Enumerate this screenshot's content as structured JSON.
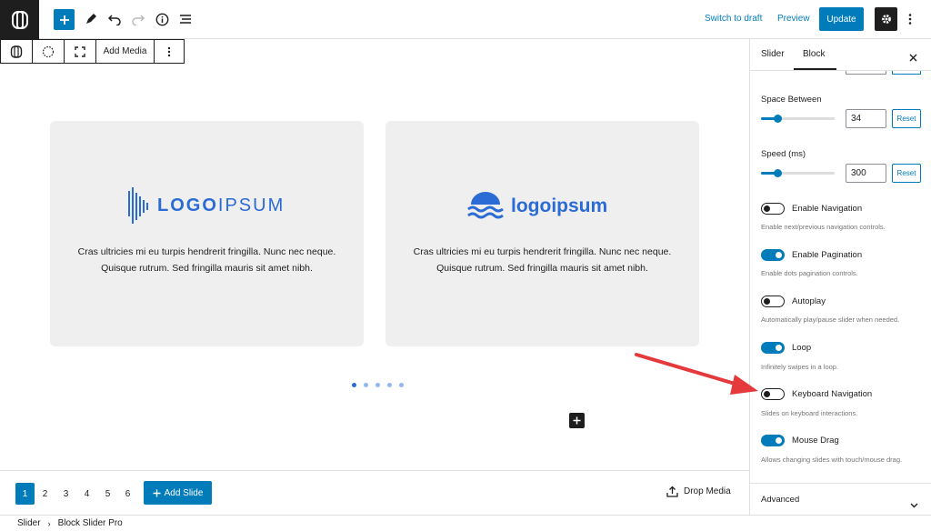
{
  "topbar": {
    "switch_to_draft": "Switch to draft",
    "preview": "Preview",
    "update": "Update"
  },
  "block_toolbar": {
    "add_media": "Add Media"
  },
  "slides": [
    {
      "logo_text_bold": "LOGO",
      "logo_text_light": "IPSUM",
      "text_line1": "Cras ultricies mi eu turpis hendrerit fringilla. Nunc nec neque.",
      "text_line2": "Quisque rutrum. Sed fringilla mauris sit amet nibh."
    },
    {
      "logo_text": "logoipsum",
      "text_line1": "Cras ultricies mi eu turpis hendrerit fringilla. Nunc nec neque.",
      "text_line2": "Quisque rutrum. Sed fringilla mauris sit amet nibh."
    }
  ],
  "pagination_dots": {
    "count": 5,
    "active_index": 0
  },
  "slide_bar": {
    "slide_numbers": [
      "1",
      "2",
      "3",
      "4",
      "5",
      "6"
    ],
    "active_slide": "1",
    "add_slide": "Add Slide",
    "drop_media": "Drop Media"
  },
  "breadcrumb": [
    "Slider",
    "Block Slider Pro"
  ],
  "sidebar": {
    "tabs": [
      "Slider",
      "Block"
    ],
    "active_tab": "Block",
    "space_between": {
      "label": "Space Between",
      "value": "34",
      "reset": "Reset",
      "fraction": 0.22
    },
    "speed": {
      "label": "Speed (ms)",
      "value": "300",
      "reset": "Reset",
      "fraction": 0.22
    },
    "toggles": [
      {
        "label": "Enable Navigation",
        "help": "Enable next/previous navigation controls.",
        "on": false
      },
      {
        "label": "Enable Pagination",
        "help": "Enable dots pagination controls.",
        "on": true
      },
      {
        "label": "Autoplay",
        "help": "Automatically play/pause slider when needed.",
        "on": false
      },
      {
        "label": "Loop",
        "help": "Infinitely swipes in a loop.",
        "on": true
      },
      {
        "label": "Keyboard Navigation",
        "help": "Slides on keyboard interactions.",
        "on": false
      },
      {
        "label": "Mouse Drag",
        "help": "Allows changing slides with touch/mouse drag.",
        "on": true
      }
    ],
    "advanced": "Advanced"
  },
  "colors": {
    "accent": "#007cba",
    "annotation_arrow": "#e5393b",
    "logo_blue": "#2b6bd6"
  }
}
